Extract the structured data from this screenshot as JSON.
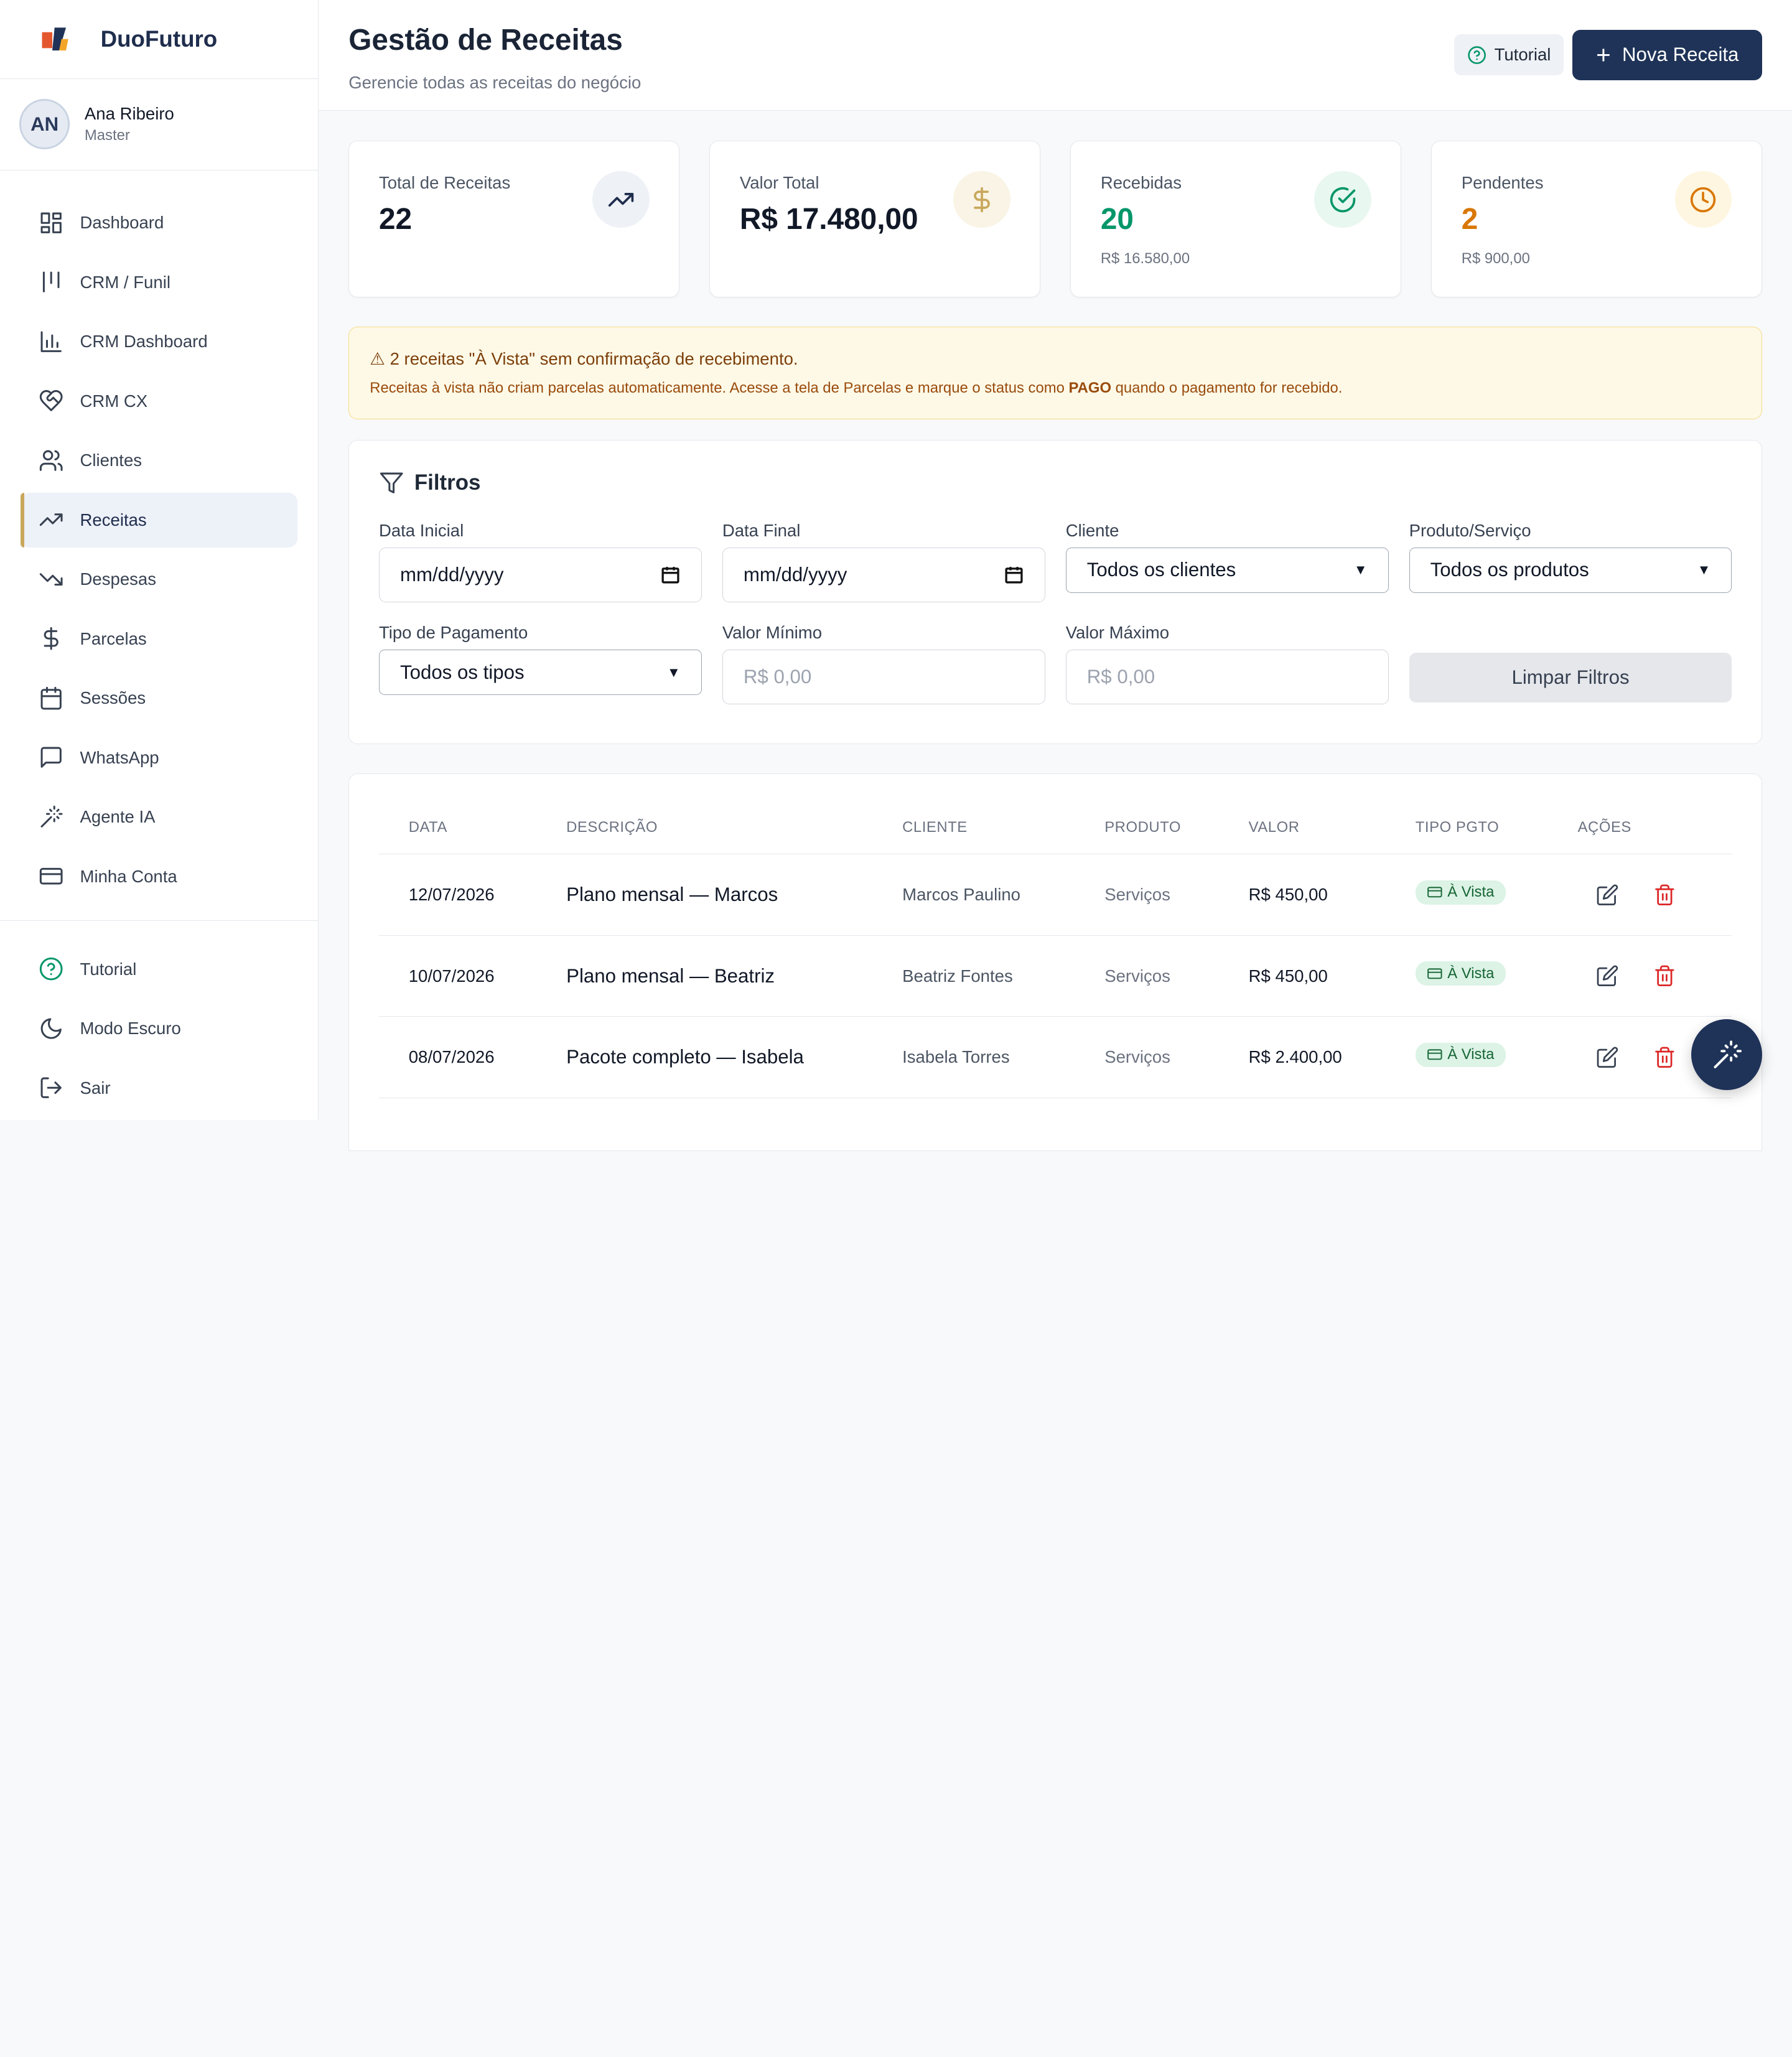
{
  "brand": {
    "name": "DuoFuturo"
  },
  "user": {
    "initials": "AN",
    "name": "Ana Ribeiro",
    "role": "Master"
  },
  "nav": [
    {
      "label": "Dashboard",
      "icon": "dashboard-icon"
    },
    {
      "label": "CRM / Funil",
      "icon": "kanban-icon"
    },
    {
      "label": "CRM Dashboard",
      "icon": "bar-chart-icon"
    },
    {
      "label": "CRM CX",
      "icon": "heart-handshake-icon"
    },
    {
      "label": "Clientes",
      "icon": "users-icon"
    },
    {
      "label": "Receitas",
      "icon": "trending-up-icon",
      "active": true
    },
    {
      "label": "Despesas",
      "icon": "trending-down-icon"
    },
    {
      "label": "Parcelas",
      "icon": "dollar-icon"
    },
    {
      "label": "Sessões",
      "icon": "calendar-icon"
    },
    {
      "label": "WhatsApp",
      "icon": "message-icon"
    },
    {
      "label": "Agente IA",
      "icon": "magic-wand-icon"
    },
    {
      "label": "Minha Conta",
      "icon": "credit-card-icon"
    }
  ],
  "nav_bottom": [
    {
      "label": "Tutorial",
      "icon": "help-circle-icon"
    },
    {
      "label": "Modo Escuro",
      "icon": "moon-icon"
    },
    {
      "label": "Sair",
      "icon": "logout-icon"
    }
  ],
  "header": {
    "title": "Gestão de Receitas",
    "subtitle": "Gerencie todas as receitas do negócio",
    "tutorial_label": "Tutorial",
    "new_label": "Nova Receita"
  },
  "cards": [
    {
      "label": "Total de Receitas",
      "value": "22",
      "sub": "",
      "icon": "trending-up-icon"
    },
    {
      "label": "Valor Total",
      "value": "R$ 17.480,00",
      "sub": "",
      "icon": "dollar-icon"
    },
    {
      "label": "Recebidas",
      "value": "20",
      "sub": "R$ 16.580,00",
      "icon": "check-circle-icon"
    },
    {
      "label": "Pendentes",
      "value": "2",
      "sub": "R$ 900,00",
      "icon": "clock-icon"
    }
  ],
  "alert": {
    "title": "⚠ 2 receitas \"À Vista\" sem confirmação de recebimento.",
    "text_before": "Receitas à vista não criam parcelas automaticamente. Acesse a tela de Parcelas e marque o status como ",
    "text_bold": "PAGO",
    "text_after": " quando o pagamento for recebido."
  },
  "filters": {
    "title": "Filtros",
    "data_inicial_label": "Data Inicial",
    "data_inicial_value": "mm/dd/yyyy",
    "data_final_label": "Data Final",
    "data_final_value": "mm/dd/yyyy",
    "cliente_label": "Cliente",
    "cliente_value": "Todos os clientes",
    "produto_label": "Produto/Serviço",
    "produto_value": "Todos os produtos",
    "tipo_label": "Tipo de Pagamento",
    "tipo_value": "Todos os tipos",
    "valor_min_label": "Valor Mínimo",
    "valor_min_placeholder": "R$ 0,00",
    "valor_max_label": "Valor Máximo",
    "valor_max_placeholder": "R$ 0,00",
    "clear_label": "Limpar Filtros"
  },
  "table": {
    "columns": [
      "DATA",
      "DESCRIÇÃO",
      "CLIENTE",
      "PRODUTO",
      "VALOR",
      "TIPO PGTO",
      "AÇÕES"
    ],
    "rows": [
      {
        "data": "12/07/2026",
        "descricao": "Plano mensal — Marcos",
        "cliente": "Marcos Paulino",
        "produto": "Serviços",
        "valor": "R$ 450,00",
        "tipo": "À Vista"
      },
      {
        "data": "10/07/2026",
        "descricao": "Plano mensal — Beatriz",
        "cliente": "Beatriz Fontes",
        "produto": "Serviços",
        "valor": "R$ 450,00",
        "tipo": "À Vista"
      },
      {
        "data": "08/07/2026",
        "descricao": "Pacote completo — Isabela",
        "cliente": "Isabela Torres",
        "produto": "Serviços",
        "valor": "R$ 2.400,00",
        "tipo": "À Vista"
      }
    ]
  },
  "colors": {
    "primary": "#1f3358",
    "accent": "#c9a85c",
    "success": "#059669",
    "warning": "#d97706"
  }
}
